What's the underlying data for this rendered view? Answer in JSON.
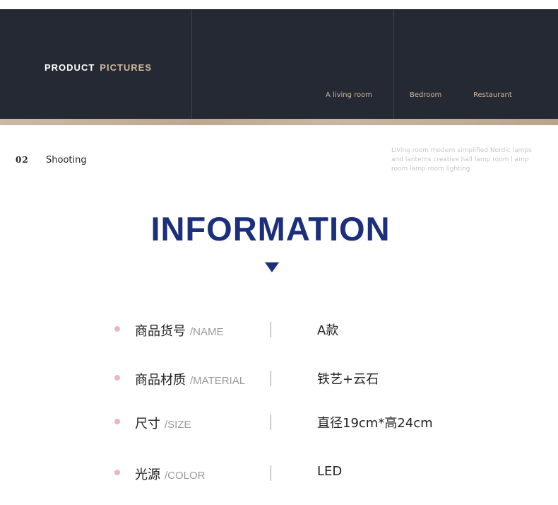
{
  "header": {
    "brand_word1": "PRODUCT",
    "brand_word2": "PICTURES",
    "nav": [
      "A living room",
      "Bedroom",
      "Restaurant"
    ]
  },
  "section": {
    "number": "02",
    "label": "Shooting",
    "description": "Living room modern simplified Nordic lamps and lanterns creative hall lamp room l amp room lamp room lighting"
  },
  "info": {
    "title": "INFORMATION",
    "rows": [
      {
        "label_cn": "商品货号",
        "label_en": "/NAME",
        "value": "A款"
      },
      {
        "label_cn": "商品材质",
        "label_en": "/MATERIAL",
        "value": "铁艺+云石"
      },
      {
        "label_cn": "尺寸",
        "label_en": "/SIZE",
        "value": "直径19cm*高24cm"
      },
      {
        "label_cn": "光源",
        "label_en": "/COLOR",
        "value": "LED"
      }
    ]
  },
  "colors": {
    "banner_bg": "#252934",
    "accent_gold": "#cdb79c",
    "title_blue": "#1c2f7c",
    "bullet_pink": "#eab7c0"
  }
}
